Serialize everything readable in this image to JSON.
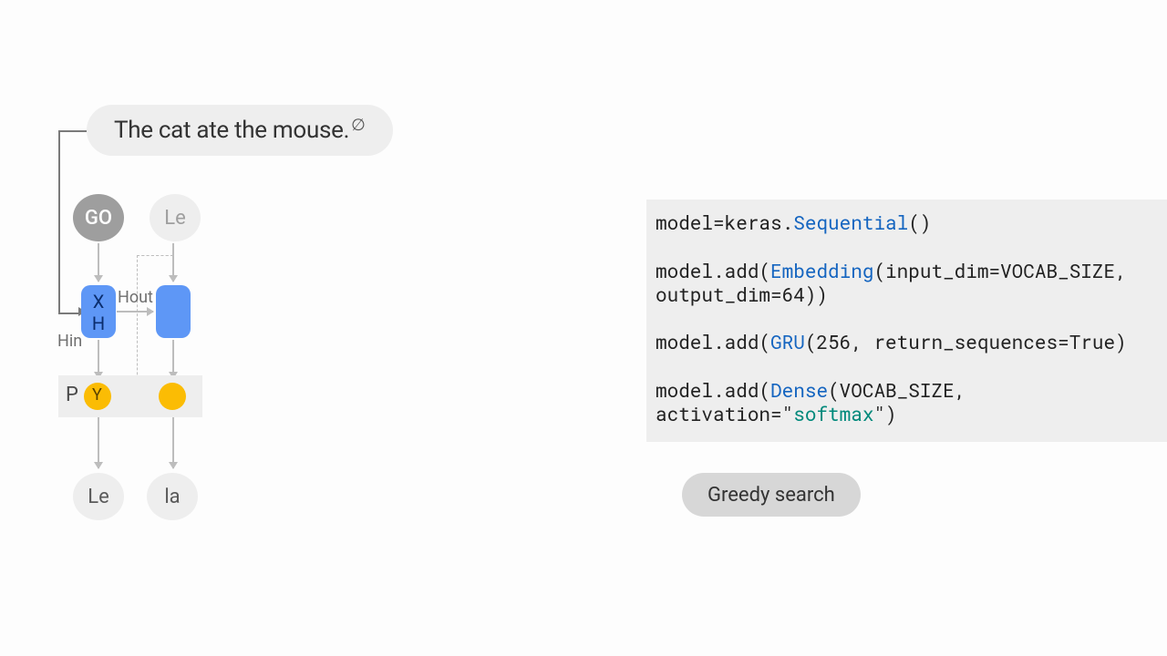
{
  "input_sentence": "The cat ate the mouse.",
  "eos_glyph": "∅",
  "tokens": {
    "go": "GO",
    "le_in": "Le"
  },
  "cell": {
    "x": "X",
    "h": "H",
    "hout": "Hout",
    "hin": "Hin"
  },
  "p_label": "P",
  "y_label": "Y",
  "outputs": {
    "le": "Le",
    "la": "la"
  },
  "code": {
    "l1a": "model=keras.",
    "l1b": "Sequential",
    "l1c": "()",
    "l2a": "model.add(",
    "l2b": "Embedding",
    "l2c": "(input_dim=VOCAB_SIZE, output_dim=64))",
    "l3a": "model.add(",
    "l3b": "GRU",
    "l3c": "(256, return_sequences=True)",
    "l4a": "model.add(",
    "l4b": "Dense",
    "l4c": "(VOCAB_SIZE, activation=\"",
    "l4d": "softmax",
    "l4e": "\")"
  },
  "button_label": "Greedy search"
}
